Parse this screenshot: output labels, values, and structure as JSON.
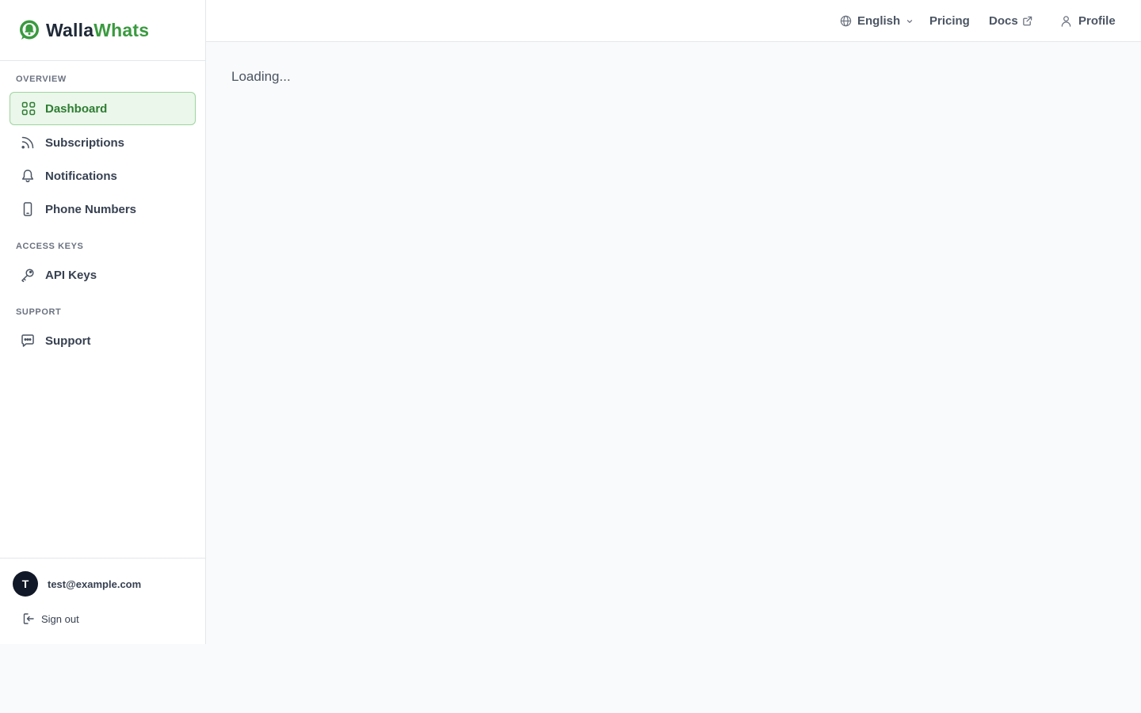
{
  "brand": {
    "name_part1": "Walla",
    "name_part2": "Whats"
  },
  "sidebar": {
    "sections": {
      "overview": "OVERVIEW",
      "access_keys": "ACCESS KEYS",
      "support": "SUPPORT"
    },
    "items": {
      "dashboard": {
        "label": "Dashboard",
        "icon": "grid-icon",
        "active": true
      },
      "subscriptions": {
        "label": "Subscriptions",
        "icon": "rss-icon"
      },
      "notifications": {
        "label": "Notifications",
        "icon": "bell-icon"
      },
      "phone_numbers": {
        "label": "Phone Numbers",
        "icon": "smartphone-icon"
      },
      "api_keys": {
        "label": "API Keys",
        "icon": "key-icon"
      },
      "support": {
        "label": "Support",
        "icon": "message-square-icon"
      }
    },
    "user": {
      "avatar_initial": "T",
      "email": "test@example.com",
      "sign_out": "Sign out"
    }
  },
  "topbar": {
    "language": "English",
    "pricing": "Pricing",
    "docs": "Docs",
    "profile": "Profile"
  },
  "main": {
    "status": "Loading..."
  },
  "colors": {
    "accent": "#3a9a3f",
    "accent_bg": "#eaf7ea",
    "accent_border": "#9fd49f",
    "page_bg": "#f9fafb",
    "avatar_bg": "#111827"
  }
}
